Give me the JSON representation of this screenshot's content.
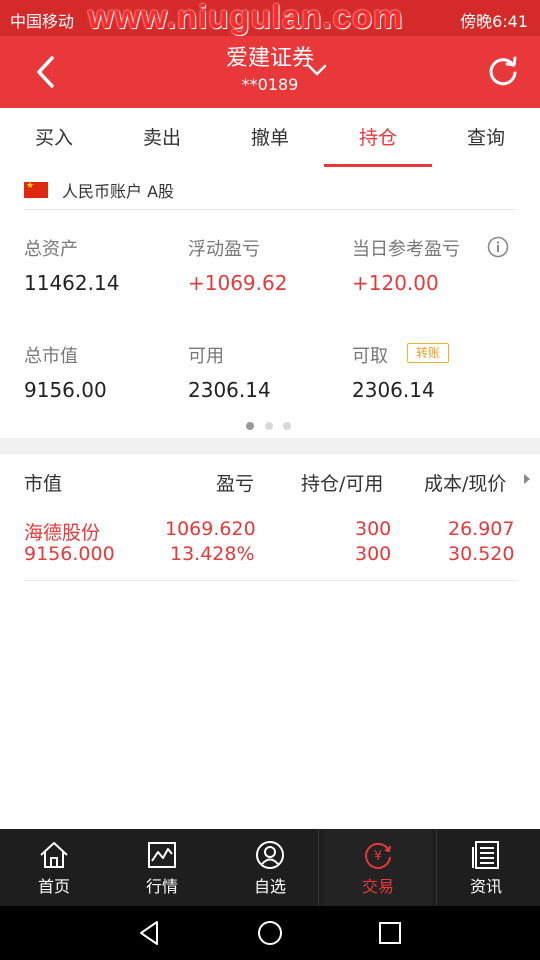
{
  "status_bar": {
    "carrier": "中国移动",
    "time": "傍晚6:41",
    "watermark": "www.niugulan.com"
  },
  "header": {
    "title": "爱建证券",
    "account_no": "**0189"
  },
  "tabs": [
    "买入",
    "卖出",
    "撤单",
    "持仓",
    "查询"
  ],
  "active_tab": "持仓",
  "account": {
    "label": "人民币账户 A股"
  },
  "stats": {
    "total_assets_label": "总资产",
    "total_assets": "11462.14",
    "float_pnl_label": "浮动盈亏",
    "float_pnl": "+1069.62",
    "daily_pnl_label": "当日参考盈亏",
    "daily_pnl": "+120.00",
    "market_value_label": "总市值",
    "market_value": "9156.00",
    "available_label": "可用",
    "available": "2306.14",
    "withdrawable_label": "可取",
    "withdrawable": "2306.14",
    "transfer_badge": "转账"
  },
  "holdings": {
    "headers": {
      "market_value": "市值",
      "pnl": "盈亏",
      "position": "持仓/可用",
      "cost_price": "成本/现价"
    },
    "rows": [
      {
        "name": "海德股份",
        "market_value": "9156.000",
        "pnl": "1069.620",
        "pnl_pct": "13.428%",
        "position": "300",
        "available": "300",
        "cost": "26.907",
        "price": "30.520"
      }
    ]
  },
  "bottom_nav": [
    "首页",
    "行情",
    "自选",
    "交易",
    "资讯"
  ],
  "active_nav": "交易",
  "colors": {
    "accent": "#e8383a",
    "nav_bg": "#1e1e1e"
  }
}
